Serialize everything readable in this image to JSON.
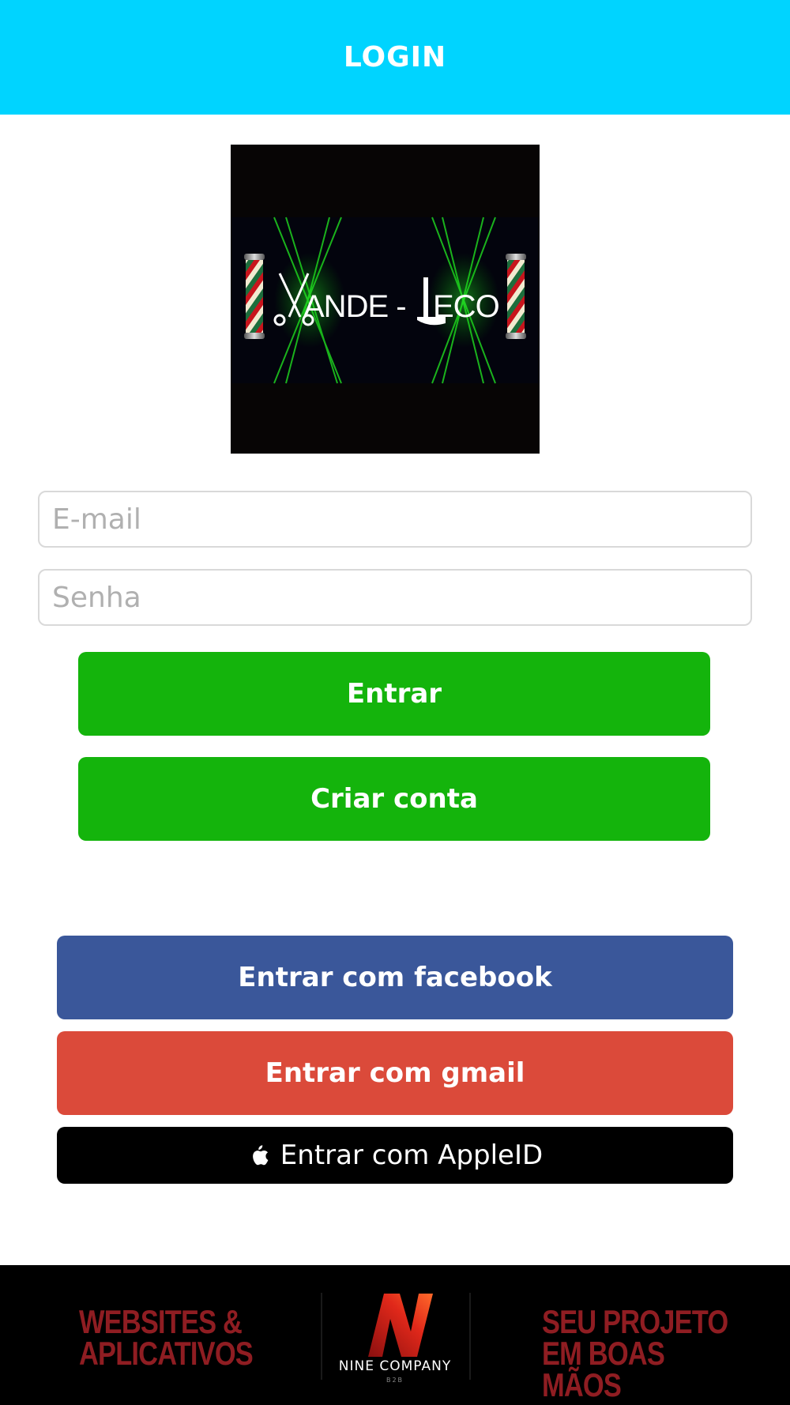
{
  "header": {
    "title": "LOGIN"
  },
  "logo": {
    "brand_text": "XANDE - LECO"
  },
  "form": {
    "email_placeholder": "E-mail",
    "email_value": "",
    "password_placeholder": "Senha",
    "password_value": "",
    "login_label": "Entrar",
    "create_account_label": "Criar conta"
  },
  "social": {
    "facebook_label": "Entrar com facebook",
    "gmail_label": "Entrar com gmail",
    "apple_label": "Entrar com AppleID"
  },
  "footer": {
    "left_line1": "WEBSITES &",
    "left_line2": "APLICATIVOS",
    "company_name": "NINE COMPANY",
    "company_sub": "B2B",
    "right_line1": "SEU PROJETO",
    "right_line2": "EM BOAS MÃOS"
  },
  "colors": {
    "header": "#00d4ff",
    "primary_green": "#14b40c",
    "facebook": "#3a579a",
    "gmail": "#db4a3a",
    "apple": "#000000",
    "footer_accent": "#8f1d22"
  },
  "icons": {
    "apple": "apple-icon",
    "brand_logo": "nine-company-logo-icon",
    "barber_pole": "barber-pole-icon",
    "scissors": "scissors-icon",
    "razor": "razor-icon"
  }
}
